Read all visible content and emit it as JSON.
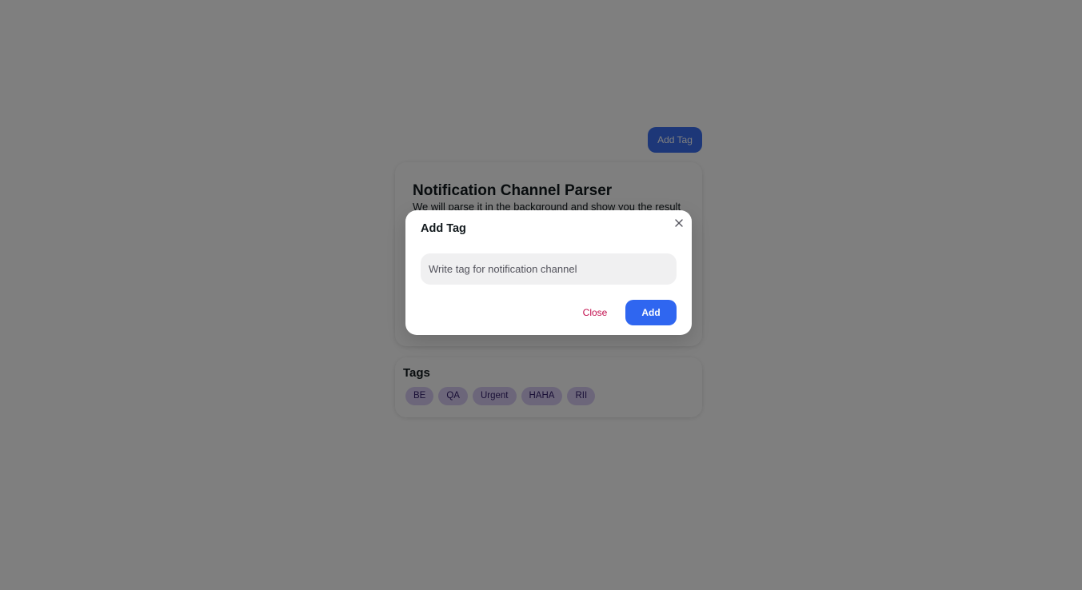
{
  "header": {
    "add_tag_label": "Add Tag"
  },
  "parser_card": {
    "title": "Notification Channel Parser",
    "subtitle": "We will parse it in the background and show you the result"
  },
  "tags_card": {
    "title": "Tags",
    "tags": [
      "BE",
      "QA",
      "Urgent",
      "HAHA",
      "RII"
    ]
  },
  "modal": {
    "title": "Add Tag",
    "close_icon": "close-icon",
    "input": {
      "value": "",
      "placeholder": "Write tag for notification channel"
    },
    "close_label": "Close",
    "add_label": "Add"
  },
  "colors": {
    "primary": "#2f66f0",
    "danger": "#c20e4d",
    "chip_bg": "#d9cdf5",
    "chip_text": "#301c6b",
    "backdrop": "rgba(0,0,0,0.5)"
  }
}
